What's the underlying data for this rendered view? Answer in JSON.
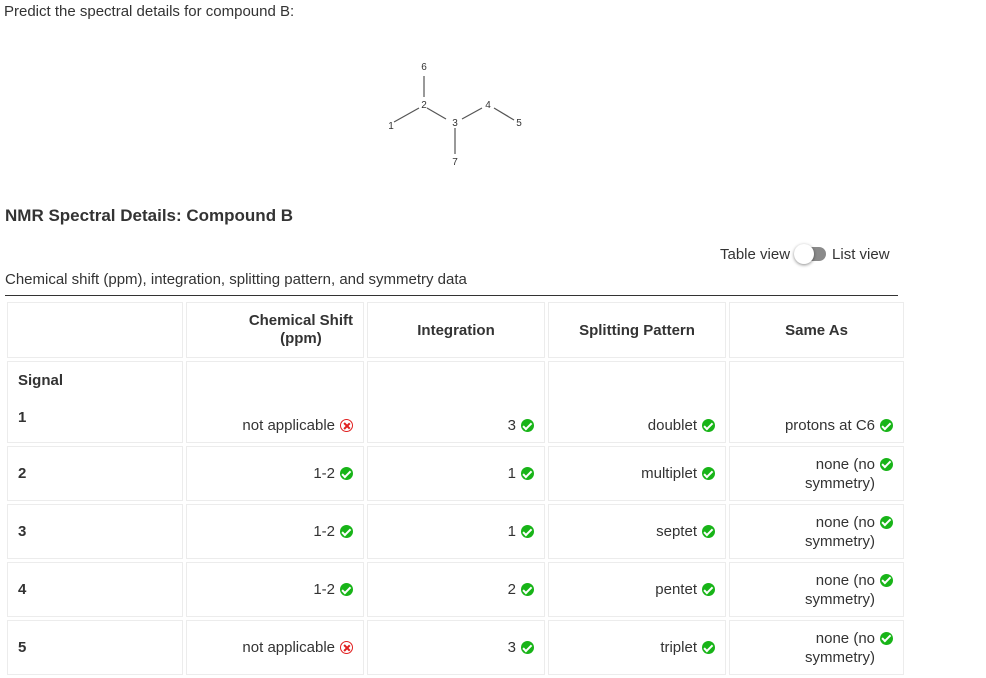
{
  "question": "Predict the spectral details for compound B:",
  "molecule": {
    "atom_labels": {
      "c1": "1",
      "c2": "2",
      "c3": "3",
      "c4": "4",
      "c5": "5",
      "c6": "6",
      "c7": "7"
    }
  },
  "section_title": "NMR Spectral Details: Compound B",
  "view_toggle": {
    "left_label": "Table view",
    "right_label": "List view"
  },
  "table_caption": "Chemical shift (ppm), integration, splitting pattern, and symmetry data",
  "columns": {
    "shift_line1": "Chemical Shift",
    "shift_line2": "(ppm)",
    "integration": "Integration",
    "splitting": "Splitting Pattern",
    "same_as": "Same As"
  },
  "signal_label": "Signal",
  "rows": [
    {
      "signal": "1",
      "shift": "not applicable",
      "shift_status": "incorrect",
      "integration": "3",
      "integration_status": "correct",
      "splitting": "doublet",
      "splitting_status": "correct",
      "same_as": "protons at C6",
      "same_as_status": "correct"
    },
    {
      "signal": "2",
      "shift": "1-2",
      "shift_status": "correct",
      "integration": "1",
      "integration_status": "correct",
      "splitting": "multiplet",
      "splitting_status": "correct",
      "same_as_line1": "none (no",
      "same_as_line2": "symmetry)",
      "same_as_status": "correct"
    },
    {
      "signal": "3",
      "shift": "1-2",
      "shift_status": "correct",
      "integration": "1",
      "integration_status": "correct",
      "splitting": "septet",
      "splitting_status": "correct",
      "same_as_line1": "none (no",
      "same_as_line2": "symmetry)",
      "same_as_status": "correct"
    },
    {
      "signal": "4",
      "shift": "1-2",
      "shift_status": "correct",
      "integration": "2",
      "integration_status": "correct",
      "splitting": "pentet",
      "splitting_status": "correct",
      "same_as_line1": "none (no",
      "same_as_line2": "symmetry)",
      "same_as_status": "correct"
    },
    {
      "signal": "5",
      "shift": "not applicable",
      "shift_status": "incorrect",
      "integration": "3",
      "integration_status": "correct",
      "splitting": "triplet",
      "splitting_status": "correct",
      "same_as_line1": "none (no",
      "same_as_line2": "symmetry)",
      "same_as_status": "correct"
    }
  ],
  "colors": {
    "correct": "#18b418",
    "incorrect": "#e02020",
    "text": "#333333"
  }
}
